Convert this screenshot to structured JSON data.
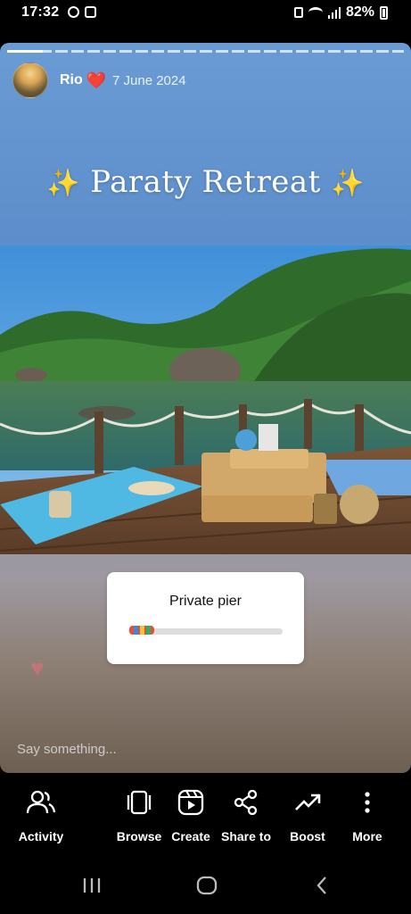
{
  "status_bar": {
    "time": "17:32",
    "battery": "82%",
    "icons": [
      "threads-icon",
      "notification-icon",
      "lock-icon",
      "wifi-icon",
      "signal-icon",
      "battery-icon"
    ]
  },
  "story": {
    "author": "Rio",
    "author_emoji": "❤️",
    "date": "7 June 2024",
    "title": "Paraty Retreat",
    "title_emoji": "✨",
    "sticker": {
      "title": "Private pier",
      "slider_value": 0.1
    },
    "reply_placeholder": "Say something..."
  },
  "toolbar": {
    "items": [
      {
        "label": "Activity",
        "icon": "activity-icon"
      },
      {
        "label": "Browse",
        "icon": "browse-icon"
      },
      {
        "label": "Create",
        "icon": "create-icon"
      },
      {
        "label": "Share to",
        "icon": "share-icon"
      },
      {
        "label": "Boost",
        "icon": "boost-icon"
      },
      {
        "label": "More",
        "icon": "more-icon"
      }
    ]
  },
  "nav": {
    "buttons": [
      "recents-icon",
      "home-icon",
      "back-icon"
    ]
  },
  "colors": {
    "background": "#000000",
    "sky": "#6a9bd4",
    "heart": "#e0202c",
    "sparkle": "#f3cb3a"
  }
}
